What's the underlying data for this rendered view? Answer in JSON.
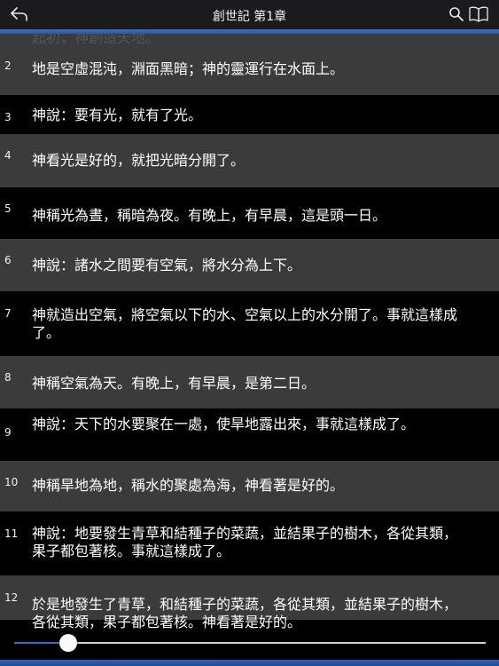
{
  "header": {
    "title": "創世記 第1章",
    "back_icon": "back-arrow-icon",
    "search_icon": "search-icon",
    "book_icon": "open-book-icon"
  },
  "colors": {
    "accent": "#2f6bd8",
    "row_gray": "#3b3b3b",
    "row_black": "#000000"
  },
  "verses": [
    {
      "num": "2",
      "text": "地是空虛混沌，淵面黑暗；神的靈運行在水面上。"
    },
    {
      "num": "3",
      "text": "神說：要有光，就有了光。"
    },
    {
      "num": "4",
      "text": "神看光是好的，就把光暗分開了。"
    },
    {
      "num": "5",
      "text": "神稱光為晝，稱暗為夜。有晚上，有早晨，這是頭一日。"
    },
    {
      "num": "6",
      "text": "神說：諸水之間要有空氣，將水分為上下。"
    },
    {
      "num": "7",
      "text": "神就造出空氣，將空氣以下的水、空氣以上的水分開了。事就這樣成了。"
    },
    {
      "num": "8",
      "text": "神稱空氣為天。有晚上，有早晨，是第二日。"
    },
    {
      "num": "9",
      "text": "神說：天下的水要聚在一處，使旱地露出來，事就這樣成了。"
    },
    {
      "num": "10",
      "text": "神稱旱地為地，稱水的聚處為海，神看著是好的。"
    },
    {
      "num": "11",
      "text": "神說：地要發生青草和結種子的菜蔬，並結果子的樹木，各從其類，果子都包著核。事就這樣成了。"
    },
    {
      "num": "12",
      "text": "於是地發生了青草，和結種子的菜蔬，各從其類，並結果子的樹木，各從其類，果子都包著核。神看著是好的。"
    }
  ],
  "slider": {
    "progress": 0.115
  }
}
